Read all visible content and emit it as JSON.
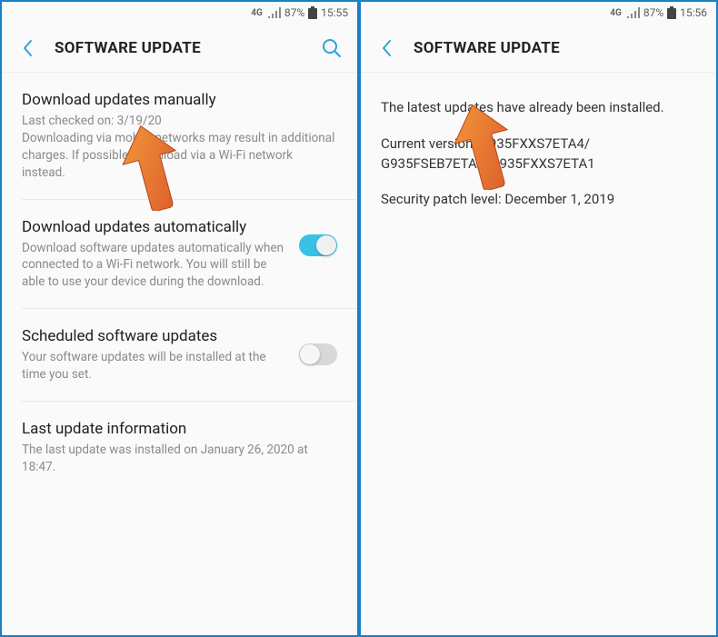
{
  "left": {
    "status": {
      "network": "4G",
      "battery": "87%",
      "time": "15:55"
    },
    "appBar": {
      "title": "SOFTWARE UPDATE"
    },
    "items": {
      "manual": {
        "title": "Download updates manually",
        "lastChecked": "Last checked on: 3/19/20",
        "desc": "Downloading via mobile networks may result in additional charges. If possible, download via a Wi-Fi network instead."
      },
      "auto": {
        "title": "Download updates automatically",
        "desc": "Download software updates automatically when connected to a Wi-Fi network. You will still be able to use your device during the download."
      },
      "scheduled": {
        "title": "Scheduled software updates",
        "desc": "Your software updates will be installed at the time you set."
      },
      "lastInfo": {
        "title": "Last update information",
        "desc": "The last update was installed on January 26, 2020 at 18:47."
      }
    }
  },
  "right": {
    "status": {
      "network": "4G",
      "battery": "87%",
      "time": "15:56"
    },
    "appBar": {
      "title": "SOFTWARE UPDATE"
    },
    "info": {
      "message": "The latest updates have already been installed.",
      "version": "Current version: G935FXXS7ETA4/ G935FSEB7ETA1/G935FXXS7ETA1",
      "patch": "Security patch level: December 1, 2019"
    }
  }
}
